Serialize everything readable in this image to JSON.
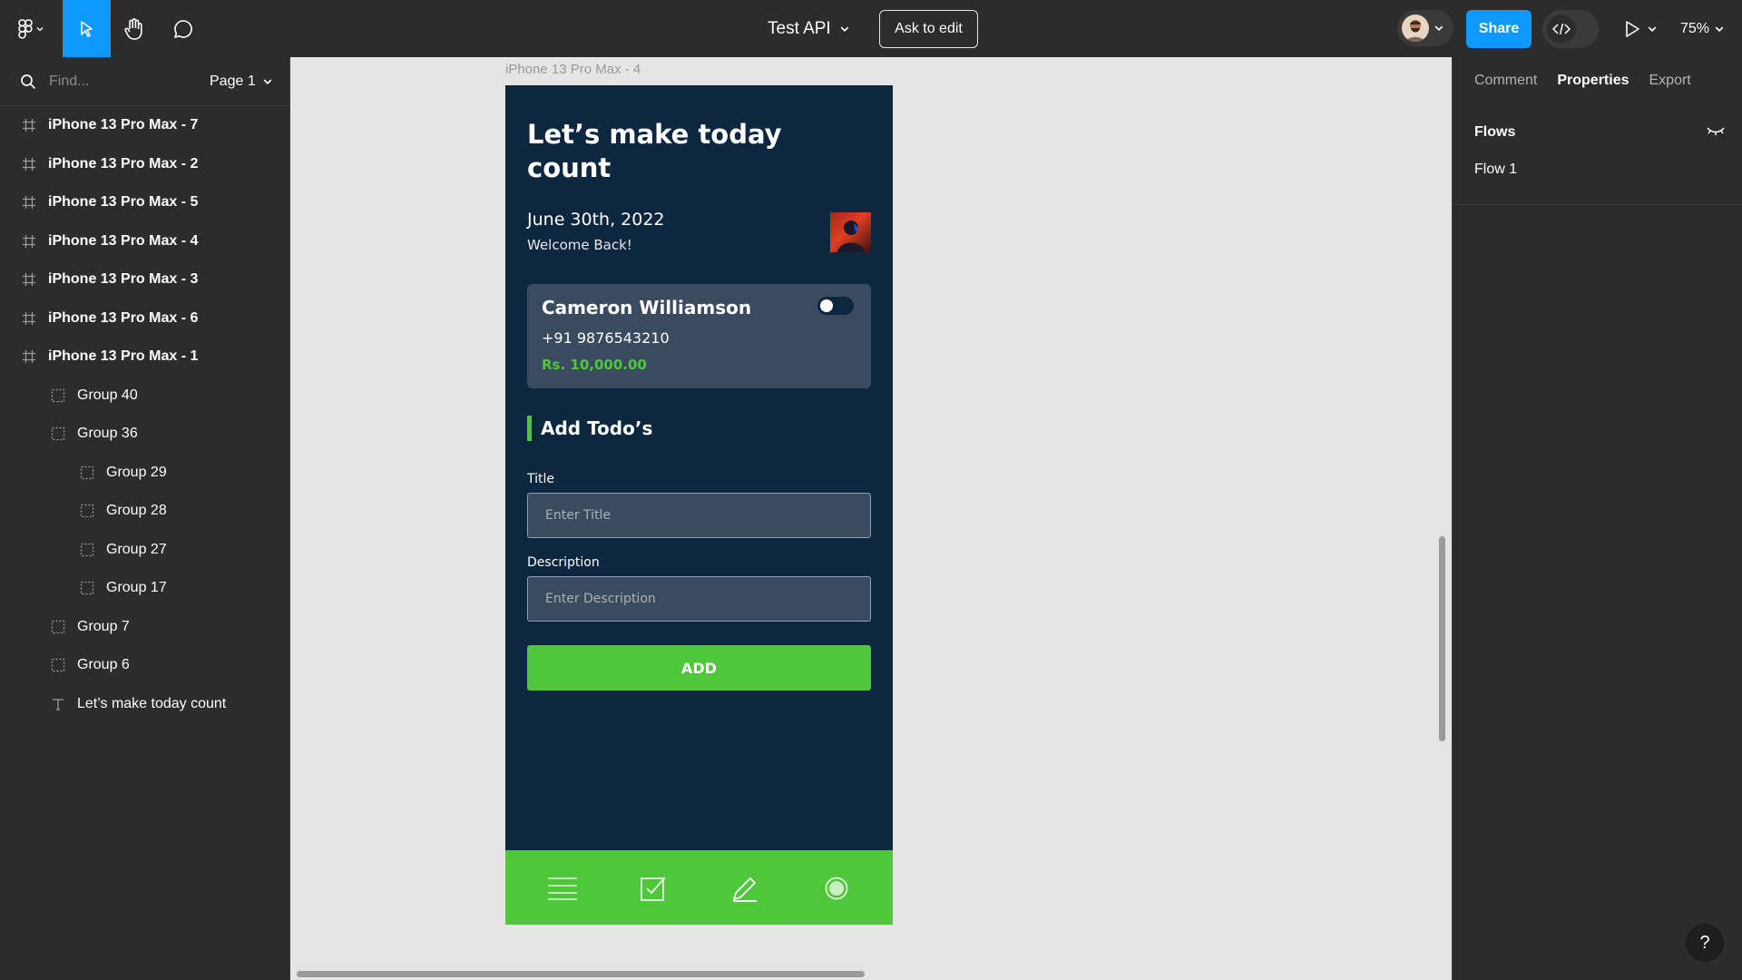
{
  "topbar": {
    "file_title": "Test API",
    "ask_to_edit": "Ask to edit",
    "share": "Share",
    "zoom": "75%"
  },
  "left_panel": {
    "search": {
      "placeholder": "Find..."
    },
    "page_selector": "Page 1",
    "layers": [
      {
        "type": "frame",
        "label": "iPhone 13 Pro Max - 7"
      },
      {
        "type": "frame",
        "label": "iPhone 13 Pro Max - 2"
      },
      {
        "type": "frame",
        "label": "iPhone 13 Pro Max - 5"
      },
      {
        "type": "frame",
        "label": "iPhone 13 Pro Max - 4"
      },
      {
        "type": "frame",
        "label": "iPhone 13 Pro Max - 3"
      },
      {
        "type": "frame",
        "label": "iPhone 13 Pro Max - 6"
      },
      {
        "type": "frame",
        "label": "iPhone 13 Pro Max - 1"
      },
      {
        "type": "group",
        "label": "Group 40"
      },
      {
        "type": "group",
        "label": "Group 36"
      },
      {
        "type": "group-nested",
        "label": "Group 29"
      },
      {
        "type": "group-nested",
        "label": "Group 28"
      },
      {
        "type": "group-nested",
        "label": "Group 27"
      },
      {
        "type": "group-nested",
        "label": "Group 17"
      },
      {
        "type": "group",
        "label": "Group 7"
      },
      {
        "type": "group",
        "label": "Group 6"
      },
      {
        "type": "text",
        "label": "Let’s make today count"
      }
    ]
  },
  "canvas": {
    "frame_label": "iPhone 13 Pro Max - 4",
    "phone": {
      "title": "Let’s make today count",
      "date": "June 30th, 2022",
      "welcome": "Welcome Back!",
      "card": {
        "name": "Cameron Williamson",
        "phone": "+91 9876543210",
        "amount": "Rs. 10,000.00"
      },
      "section_title": "Add Todo’s",
      "title_label": "Title",
      "title_placeholder": "Enter Title",
      "description_label": "Description",
      "description_placeholder": "Enter Description",
      "add_button": "ADD",
      "nav_icons": [
        "menu-icon",
        "checkbox-icon",
        "pencil-icon",
        "record-icon"
      ]
    }
  },
  "right_panel": {
    "tabs": [
      {
        "label": "Comment",
        "active": false
      },
      {
        "label": "Properties",
        "active": true
      },
      {
        "label": "Export",
        "active": false
      }
    ],
    "flows_title": "Flows",
    "flow_items": [
      "Flow 1"
    ]
  },
  "help": "?",
  "colors": {
    "accent": "#0d99ff",
    "phone_bg": "#0e2740",
    "brand_green": "#4fc73a",
    "panel_bg": "#2c2c2c",
    "canvas_bg": "#e5e5e5"
  }
}
